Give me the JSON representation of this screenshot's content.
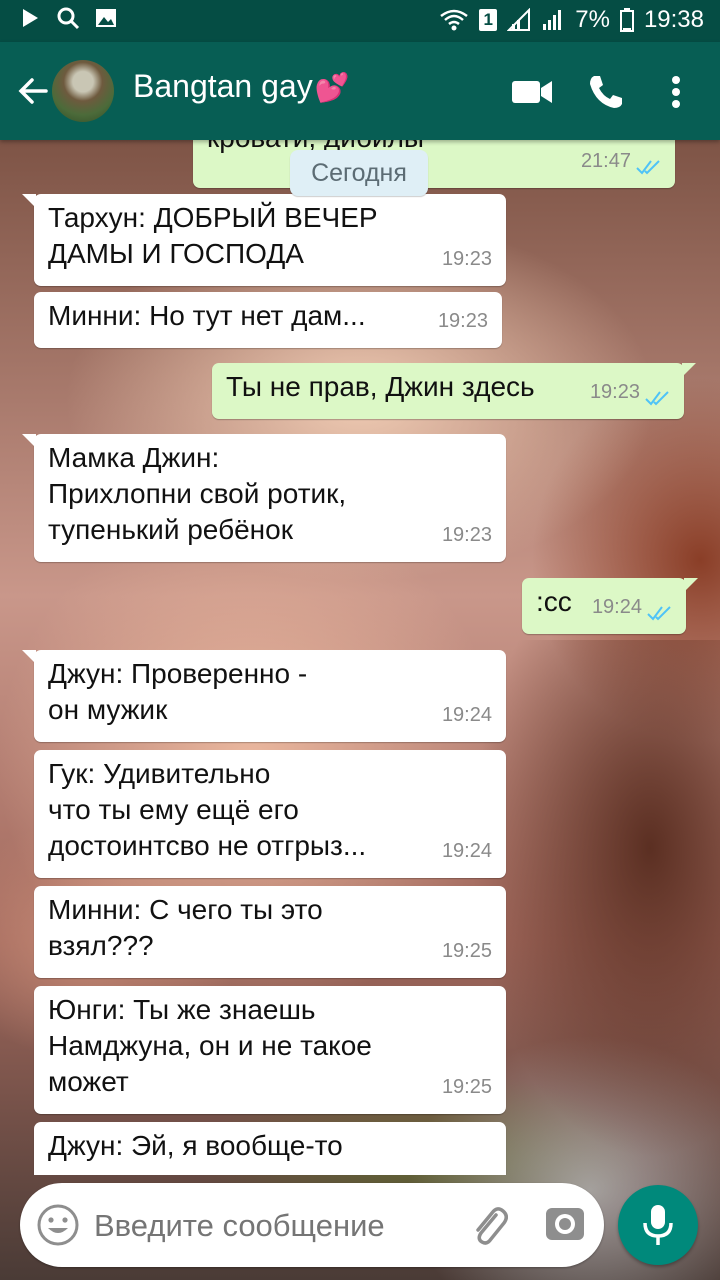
{
  "status_bar": {
    "battery": "7%",
    "time": "19:38",
    "sim": "1",
    "icons": [
      "play-icon",
      "search-icon",
      "image-icon",
      "wifi-icon",
      "sim-icon",
      "signal-icon",
      "signal-icon-2",
      "battery-icon"
    ]
  },
  "header": {
    "title": "Bangtan gay",
    "emoji": "💕",
    "back_icon": "arrow-left-icon",
    "actions": [
      "video-call-icon",
      "phone-icon",
      "more-vert-icon"
    ]
  },
  "colors": {
    "appbar": "#075e54",
    "statusbar": "#054d44",
    "outgoing": "#dcf8c6",
    "incoming": "#ffffff",
    "fab": "#00897b"
  },
  "date_chip": "Сегодня",
  "messages": [
    {
      "dir": "out",
      "text": "кровати, дибилы",
      "time": "21:47"
    },
    {
      "dir": "in",
      "text": "Тархун: ДОБРЫЙ ВЕЧЕР\nДАМЫ И ГОСПОДА",
      "time": "19:23"
    },
    {
      "dir": "in",
      "text": "Минни: Но тут нет дам...",
      "time": "19:23"
    },
    {
      "dir": "out",
      "text": "Ты не прав, Джин здесь",
      "time": "19:23"
    },
    {
      "dir": "in",
      "text": "Мамка Джин:\nПрихлопни свой ротик,\nтупенький ребёнок",
      "time": "19:23"
    },
    {
      "dir": "out",
      "text": ":cc",
      "time": "19:24"
    },
    {
      "dir": "in",
      "text": "Джун: Проверенно -\nон мужик",
      "time": "19:24"
    },
    {
      "dir": "in",
      "text": "Гук: Удивительно\nчто ты ему ещё его\nдостоинтсво не отгрыз...",
      "time": "19:24"
    },
    {
      "dir": "in",
      "text": "Минни: С чего ты это\nвзял???",
      "time": "19:25"
    },
    {
      "dir": "in",
      "text": "Юнги: Ты же знаешь\nНамджуна, он и не такое\nможет",
      "time": "19:25"
    },
    {
      "dir": "in",
      "text": "Джун: Эй, я вообще-то",
      "time": ""
    }
  ],
  "composer": {
    "placeholder": "Введите сообщение",
    "icons": [
      "emoji-icon",
      "attach-icon",
      "camera-icon",
      "mic-icon"
    ]
  }
}
